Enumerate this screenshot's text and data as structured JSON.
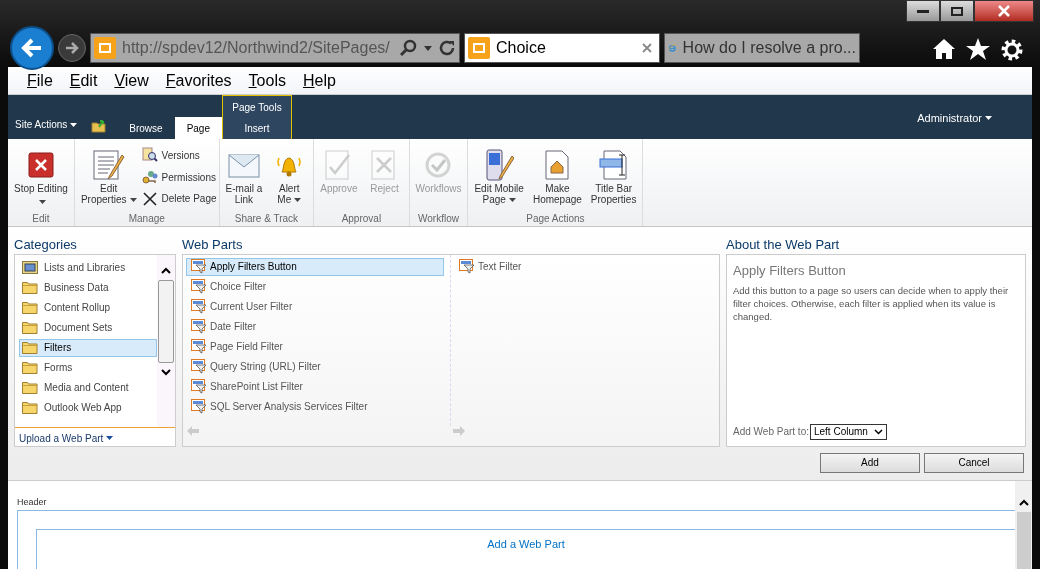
{
  "browser": {
    "address": "http://spdev12/Northwind2/SitePages/",
    "tabs": [
      {
        "title": "Choice",
        "selected": true,
        "kind": "sharepoint"
      },
      {
        "title": "How do I resolve a pro...",
        "selected": false,
        "kind": "ie"
      }
    ]
  },
  "menu": [
    "File",
    "Edit",
    "View",
    "Favorites",
    "Tools",
    "Help"
  ],
  "ribbon": {
    "site_actions": "Site Actions",
    "context_group": "Page Tools",
    "user": "Administrator",
    "tabs": [
      {
        "label": "Browse",
        "selected": false,
        "contextual": false
      },
      {
        "label": "Page",
        "selected": true,
        "contextual": false
      },
      {
        "label": "Insert",
        "selected": false,
        "contextual": true
      }
    ],
    "groups": [
      {
        "label": "Edit",
        "buttons": [
          {
            "kind": "large",
            "lines": [
              "Stop Editing"
            ],
            "dropdown": true,
            "disabled": false
          }
        ]
      },
      {
        "label": "Manage",
        "buttons": [
          {
            "kind": "large",
            "lines": [
              "Edit",
              "Properties"
            ],
            "dropdown": true,
            "disabled": false
          },
          {
            "kind": "small",
            "lines": [
              "Versions"
            ],
            "dropdown": false,
            "disabled": false
          },
          {
            "kind": "small",
            "lines": [
              "Permissions"
            ],
            "dropdown": false,
            "disabled": false
          },
          {
            "kind": "small",
            "lines": [
              "Delete Page"
            ],
            "dropdown": false,
            "disabled": false
          }
        ]
      },
      {
        "label": "Share & Track",
        "buttons": [
          {
            "kind": "large",
            "lines": [
              "E-mail a",
              "Link"
            ],
            "dropdown": false,
            "disabled": false
          },
          {
            "kind": "large",
            "lines": [
              "Alert",
              "Me"
            ],
            "dropdown": true,
            "disabled": false
          }
        ]
      },
      {
        "label": "Approval",
        "buttons": [
          {
            "kind": "large",
            "lines": [
              "Approve"
            ],
            "dropdown": false,
            "disabled": true
          },
          {
            "kind": "large",
            "lines": [
              "Reject"
            ],
            "dropdown": false,
            "disabled": true
          }
        ]
      },
      {
        "label": "Workflow",
        "buttons": [
          {
            "kind": "large",
            "lines": [
              "Workflows"
            ],
            "dropdown": false,
            "disabled": true
          }
        ]
      },
      {
        "label": "Page Actions",
        "buttons": [
          {
            "kind": "large",
            "lines": [
              "Edit Mobile",
              "Page"
            ],
            "dropdown": true,
            "disabled": false
          },
          {
            "kind": "large",
            "lines": [
              "Make",
              "Homepage"
            ],
            "dropdown": false,
            "disabled": false
          },
          {
            "kind": "large",
            "lines": [
              "Title Bar",
              "Properties"
            ],
            "dropdown": false,
            "disabled": false
          }
        ]
      }
    ]
  },
  "gallery": {
    "categories_title": "Categories",
    "web_parts_title": "Web Parts",
    "about_title": "About the Web Part",
    "categories": [
      {
        "label": "Lists and Libraries",
        "selected": false,
        "kind": "list"
      },
      {
        "label": "Business Data",
        "selected": false,
        "kind": "folder"
      },
      {
        "label": "Content Rollup",
        "selected": false,
        "kind": "folder"
      },
      {
        "label": "Document Sets",
        "selected": false,
        "kind": "folder"
      },
      {
        "label": "Filters",
        "selected": true,
        "kind": "folder"
      },
      {
        "label": "Forms",
        "selected": false,
        "kind": "folder"
      },
      {
        "label": "Media and Content",
        "selected": false,
        "kind": "folder"
      },
      {
        "label": "Outlook Web App",
        "selected": false,
        "kind": "folder"
      }
    ],
    "upload": "Upload a Web Part",
    "web_part_columns": [
      [
        {
          "label": "Apply Filters Button",
          "selected": true
        },
        {
          "label": "Choice Filter",
          "selected": false
        },
        {
          "label": "Current User Filter",
          "selected": false
        },
        {
          "label": "Date Filter",
          "selected": false
        },
        {
          "label": "Page Field Filter",
          "selected": false
        },
        {
          "label": "Query String (URL) Filter",
          "selected": false
        },
        {
          "label": "SharePoint List Filter",
          "selected": false
        },
        {
          "label": "SQL Server Analysis Services Filter",
          "selected": false
        }
      ],
      [
        {
          "label": "Text Filter",
          "selected": false
        }
      ]
    ],
    "about": {
      "name": "Apply Filters Button",
      "description": "Add this button to a page so users can decide when to apply their filter choices. Otherwise, each filter is applied when its value is changed.",
      "add_to_label": "Add Web Part to:",
      "add_to_value": "Left Column"
    },
    "buttons": [
      "Add",
      "Cancel"
    ]
  },
  "page": {
    "zone_label": "Header",
    "add_link": "Add a Web Part"
  }
}
